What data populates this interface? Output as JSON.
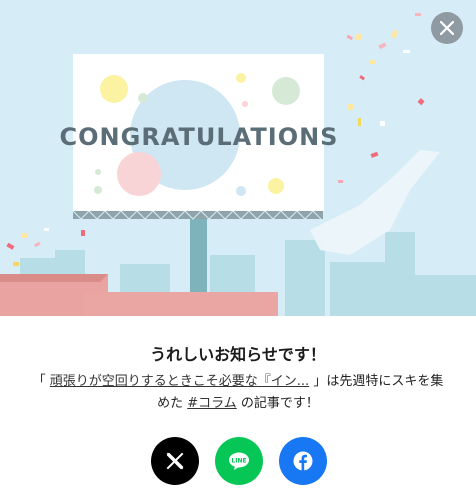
{
  "hero": {
    "billboard_text": "CONGRATULATIONS",
    "colors": {
      "sky": "#d6ecf6",
      "billboard": "#ffffff",
      "text": "#5b6d76",
      "roof": "#e9a4a1"
    }
  },
  "close": {
    "icon": "close-icon"
  },
  "message": {
    "headline": "うれしいお知らせです！",
    "open_quote": "「",
    "article_link": "頑張りが空回りするときこそ必要な『イン...",
    "middle_text": "」は先週特にスキを集めた",
    "hashtag": "#コラム",
    "tail_text": "の記事です！"
  },
  "share": {
    "x": {
      "icon": "x-logo-icon",
      "color": "#000000"
    },
    "line": {
      "icon": "line-logo-icon",
      "label": "LINE",
      "color": "#06c755"
    },
    "facebook": {
      "icon": "facebook-logo-icon",
      "color": "#1877f2"
    }
  }
}
